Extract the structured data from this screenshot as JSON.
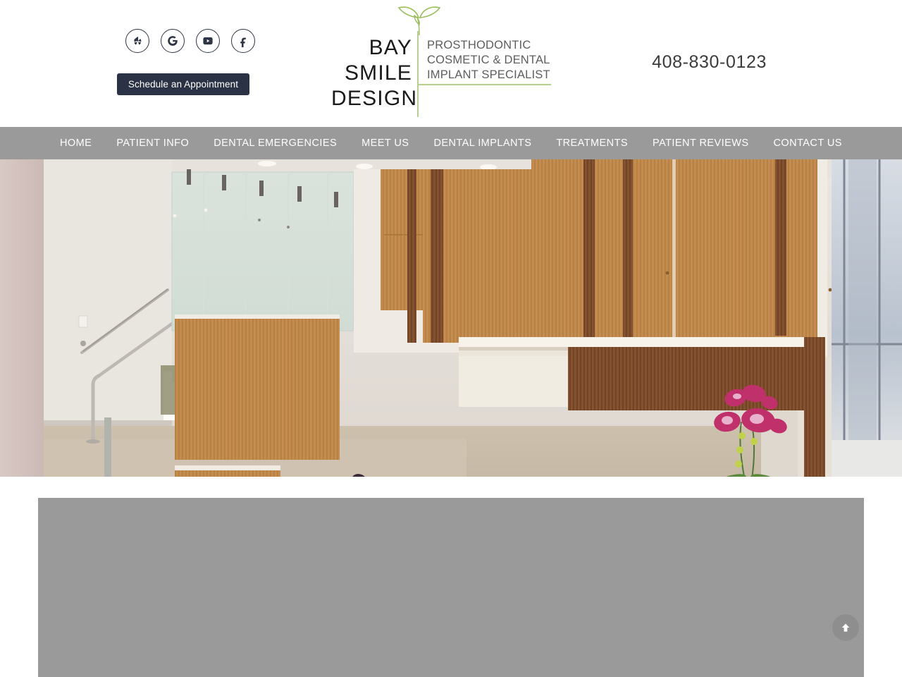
{
  "header": {
    "social": [
      {
        "name": "yelp-icon",
        "label": "Yelp"
      },
      {
        "name": "google-icon",
        "label": "Google"
      },
      {
        "name": "youtube-icon",
        "label": "YouTube"
      },
      {
        "name": "facebook-icon",
        "label": "Facebook"
      }
    ],
    "cta_label": "Schedule an Appointment",
    "phone": "408-830-0123",
    "logo": {
      "name_line1": "BAY",
      "name_line2": "SMILE",
      "name_line3": "DESIGN",
      "tag_line1": "PROSTHODONTIC",
      "tag_line2": "COSMETIC & DENTAL",
      "tag_line3": "IMPLANT SPECIALIST",
      "sprout_color": "#8cb04a",
      "rule_color": "#b9cf8f"
    }
  },
  "nav": {
    "background": "#9a9a9a",
    "items": [
      {
        "label": "HOME"
      },
      {
        "label": "PATIENT INFO"
      },
      {
        "label": "DENTAL EMERGENCIES"
      },
      {
        "label": "MEET US"
      },
      {
        "label": "DENTAL IMPLANTS"
      },
      {
        "label": "TREATMENTS"
      },
      {
        "label": "PATIENT REVIEWS"
      },
      {
        "label": "CONTACT US"
      }
    ]
  },
  "hero": {
    "alt": "Dental office lobby with staircase, frosted glass partition and curved wood reception desk"
  },
  "content": {
    "placeholder_color": "#9a9a9a"
  },
  "scroll_top": {
    "label": "Back to top"
  }
}
